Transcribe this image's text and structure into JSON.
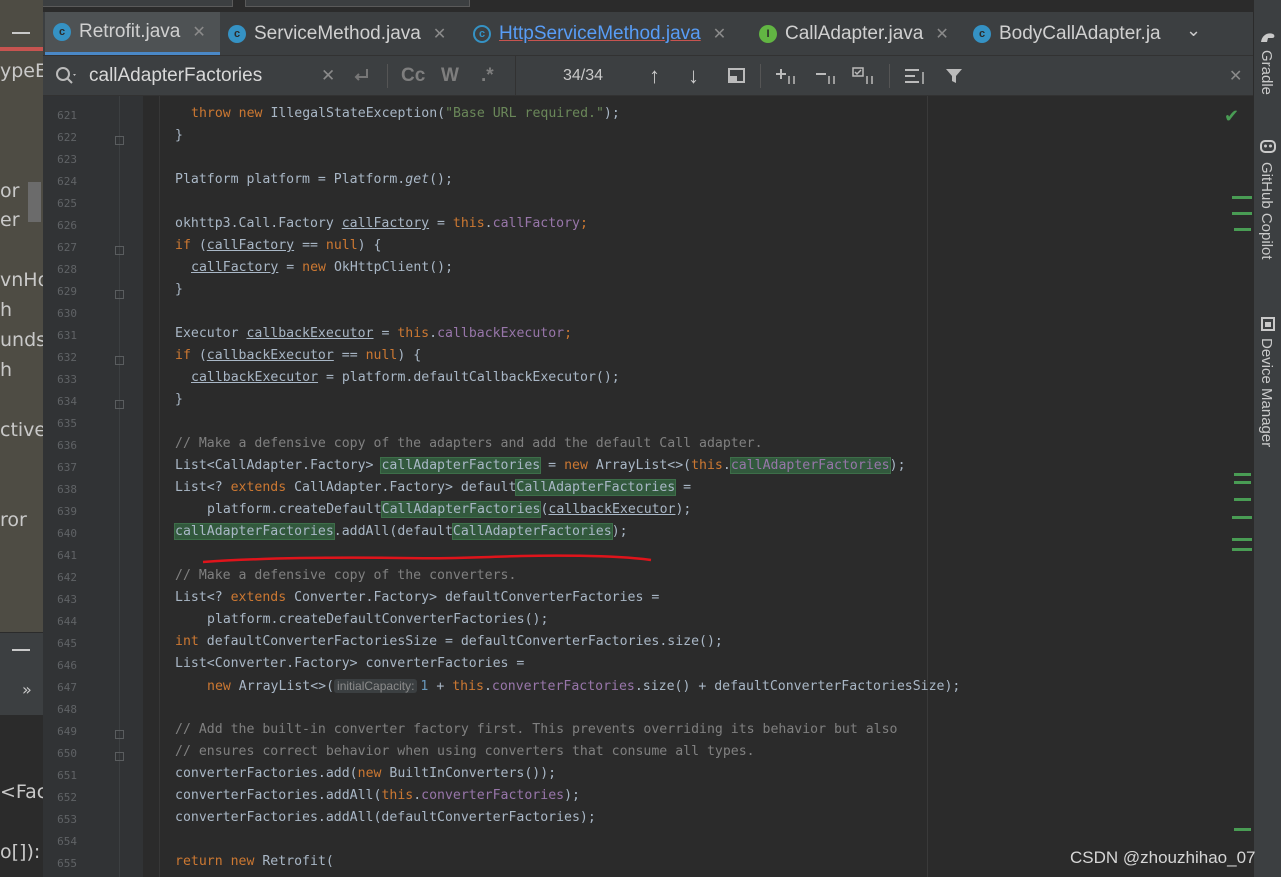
{
  "left_panel": {
    "fragments": [
      "ypeEx",
      "or",
      "er",
      "vnHo",
      "h",
      "unds",
      "h",
      "ctive",
      "ror",
      "<Fac",
      "o[]): C"
    ],
    "chevron": "»"
  },
  "tabs": [
    {
      "label": "Retrofit.java",
      "icon": "c",
      "active": true,
      "close": "✕"
    },
    {
      "label": "ServiceMethod.java",
      "icon": "c",
      "active": false,
      "close": "✕"
    },
    {
      "label": "HttpServiceMethod.java",
      "icon": "c",
      "active": false,
      "close": "✕",
      "error": true
    },
    {
      "label": "CallAdapter.java",
      "icon": "i",
      "active": false,
      "close": "✕"
    },
    {
      "label": "BodyCallAdapter.ja",
      "icon": "c",
      "active": false,
      "close": ""
    }
  ],
  "tab_more": "⌄",
  "tab_menu": "⋮",
  "search": {
    "value": "callAdapterFactories",
    "match_case": "Cc",
    "words": "W",
    "regex": ".*",
    "count": "34/34",
    "up": "↑",
    "down": "↓",
    "clear": "✕",
    "close": "✕"
  },
  "line_numbers": [
    "621",
    "622",
    "623",
    "624",
    "625",
    "626",
    "627",
    "628",
    "629",
    "630",
    "631",
    "632",
    "633",
    "634",
    "635",
    "636",
    "637",
    "638",
    "639",
    "640",
    "641",
    "642",
    "643",
    "644",
    "645",
    "646",
    "647",
    "648",
    "649",
    "650",
    "651",
    "652",
    "653",
    "654",
    "655"
  ],
  "code": {
    "l621_a": "throw",
    "l621_b": "new",
    "l621_c": "IllegalStateException(",
    "l621_d": "\"Base URL required.\"",
    "l621_e": ");",
    "l622": "}",
    "l624_a": "Platform platform = Platform.",
    "l624_b": "get",
    "l624_c": "();",
    "l626_a": "okhttp3.Call.Factory ",
    "l626_b": "callFactory",
    "l626_c": " = ",
    "l626_d": "this",
    "l626_e": ".",
    "l626_f": "callFactory",
    "l626_g": ";",
    "l627_a": "if",
    "l627_b": " (",
    "l627_c": "callFactory",
    "l627_d": " == ",
    "l627_e": "null",
    "l627_f": ") {",
    "l628_a": "callFactory",
    "l628_b": " = ",
    "l628_c": "new",
    "l628_d": " OkHttpClient();",
    "l629": "}",
    "l631_a": "Executor ",
    "l631_b": "callbackExecutor",
    "l631_c": " = ",
    "l631_d": "this",
    "l631_e": ".",
    "l631_f": "callbackExecutor",
    "l631_g": ";",
    "l632_a": "if",
    "l632_b": " (",
    "l632_c": "callbackExecutor",
    "l632_d": " == ",
    "l632_e": "null",
    "l632_f": ") {",
    "l633_a": "callbackExecutor",
    "l633_b": " = platform.defaultCallbackExecutor();",
    "l634": "}",
    "l636": "// Make a defensive copy of the adapters and add the default Call adapter.",
    "l637_a": "List<CallAdapter.Factory> ",
    "l637_b": "callAdapterFactories",
    "l637_c": " = ",
    "l637_d": "new",
    "l637_e": " ArrayList<>(",
    "l637_f": "this",
    "l637_g": ".",
    "l637_h": "callAdapterFactories",
    "l637_i": ");",
    "l638_a": "List<? ",
    "l638_b": "extends",
    "l638_c": " CallAdapter.Factory> default",
    "l638_d": "CallAdapterFactories",
    "l638_e": " =",
    "l639_a": "platform.createDefault",
    "l639_b": "CallAdapterFactories",
    "l639_c": "(",
    "l639_d": "callbackExecutor",
    "l639_e": ");",
    "l640_a": "callAdapterFactories",
    "l640_b": ".addAll(default",
    "l640_c": "CallAdapterFactories",
    "l640_d": ");",
    "l642": "// Make a defensive copy of the converters.",
    "l643_a": "List<? ",
    "l643_b": "extends",
    "l643_c": " Converter.Factory> defaultConverterFactories =",
    "l644": "platform.createDefaultConverterFactories();",
    "l645_a": "int",
    "l645_b": " defaultConverterFactoriesSize = defaultConverterFactories.size();",
    "l646": "List<Converter.Factory> converterFactories =",
    "l647_a": "new",
    "l647_b": " ArrayList<>(",
    "l647_hint": "initialCapacity:",
    "l647_c": "1",
    "l647_d": " + ",
    "l647_e": "this",
    "l647_f": ".",
    "l647_g": "converterFactories",
    "l647_h": ".size() + defaultConverterFactoriesSize);",
    "l649": "// Add the built-in converter factory first. This prevents overriding its behavior but also",
    "l650": "// ensures correct behavior when using converters that consume all types.",
    "l651_a": "converterFactories.add(",
    "l651_b": "new",
    "l651_c": " BuiltInConverters());",
    "l652_a": "converterFactories.addAll(",
    "l652_b": "this",
    "l652_c": ".",
    "l652_d": "converterFactories",
    "l652_e": ");",
    "l653": "converterFactories.addAll(defaultConverterFactories);",
    "l655_a": "return",
    "l655_b": " ",
    "l655_c": "new",
    "l655_d": " Retrofit("
  },
  "right_strip": {
    "gradle": "Gradle",
    "copilot": "GitHub Copilot",
    "device_manager": "Device Manager"
  },
  "watermark": "CSDN @zhouzhihao_07",
  "colors": {
    "keyword": "#cc7832",
    "string": "#6a8759",
    "field": "#9876aa",
    "comment": "#808080",
    "match_highlight": "#32593d",
    "annotation_red": "#e0141b"
  }
}
